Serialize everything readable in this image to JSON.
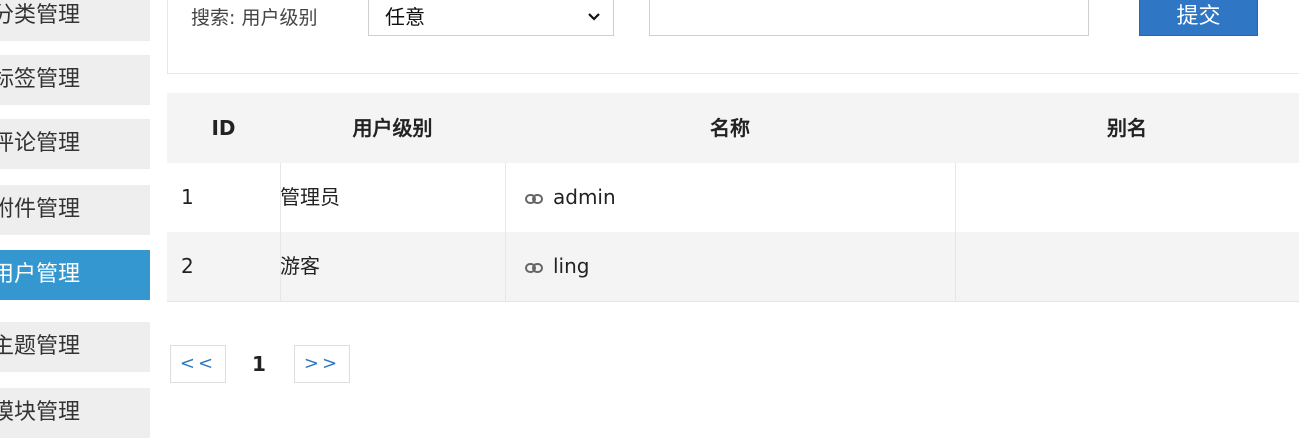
{
  "sidebar": {
    "items": [
      {
        "label": "分类管理",
        "active": false
      },
      {
        "label": "标签管理",
        "active": false
      },
      {
        "label": "评论管理",
        "active": false
      },
      {
        "label": "附件管理",
        "active": false
      },
      {
        "label": "用户管理",
        "active": true
      },
      {
        "label": "主题管理",
        "active": false
      },
      {
        "label": "模块管理",
        "active": false
      }
    ]
  },
  "search": {
    "label": "搜索: 用户级别",
    "select_value": "任意",
    "input_value": "",
    "submit_label": "提交"
  },
  "table": {
    "headers": [
      "ID",
      "用户级别",
      "名称",
      "别名"
    ],
    "rows": [
      {
        "id": "1",
        "level": "管理员",
        "name": "admin",
        "alias": ""
      },
      {
        "id": "2",
        "level": "游客",
        "name": "ling",
        "alias": ""
      }
    ]
  },
  "pagination": {
    "prev_label": "<<",
    "current": "1",
    "next_label": ">>"
  },
  "colors": {
    "active_nav": "#3497d0",
    "submit_button": "#2f77c4",
    "link": "#2f77c4"
  }
}
